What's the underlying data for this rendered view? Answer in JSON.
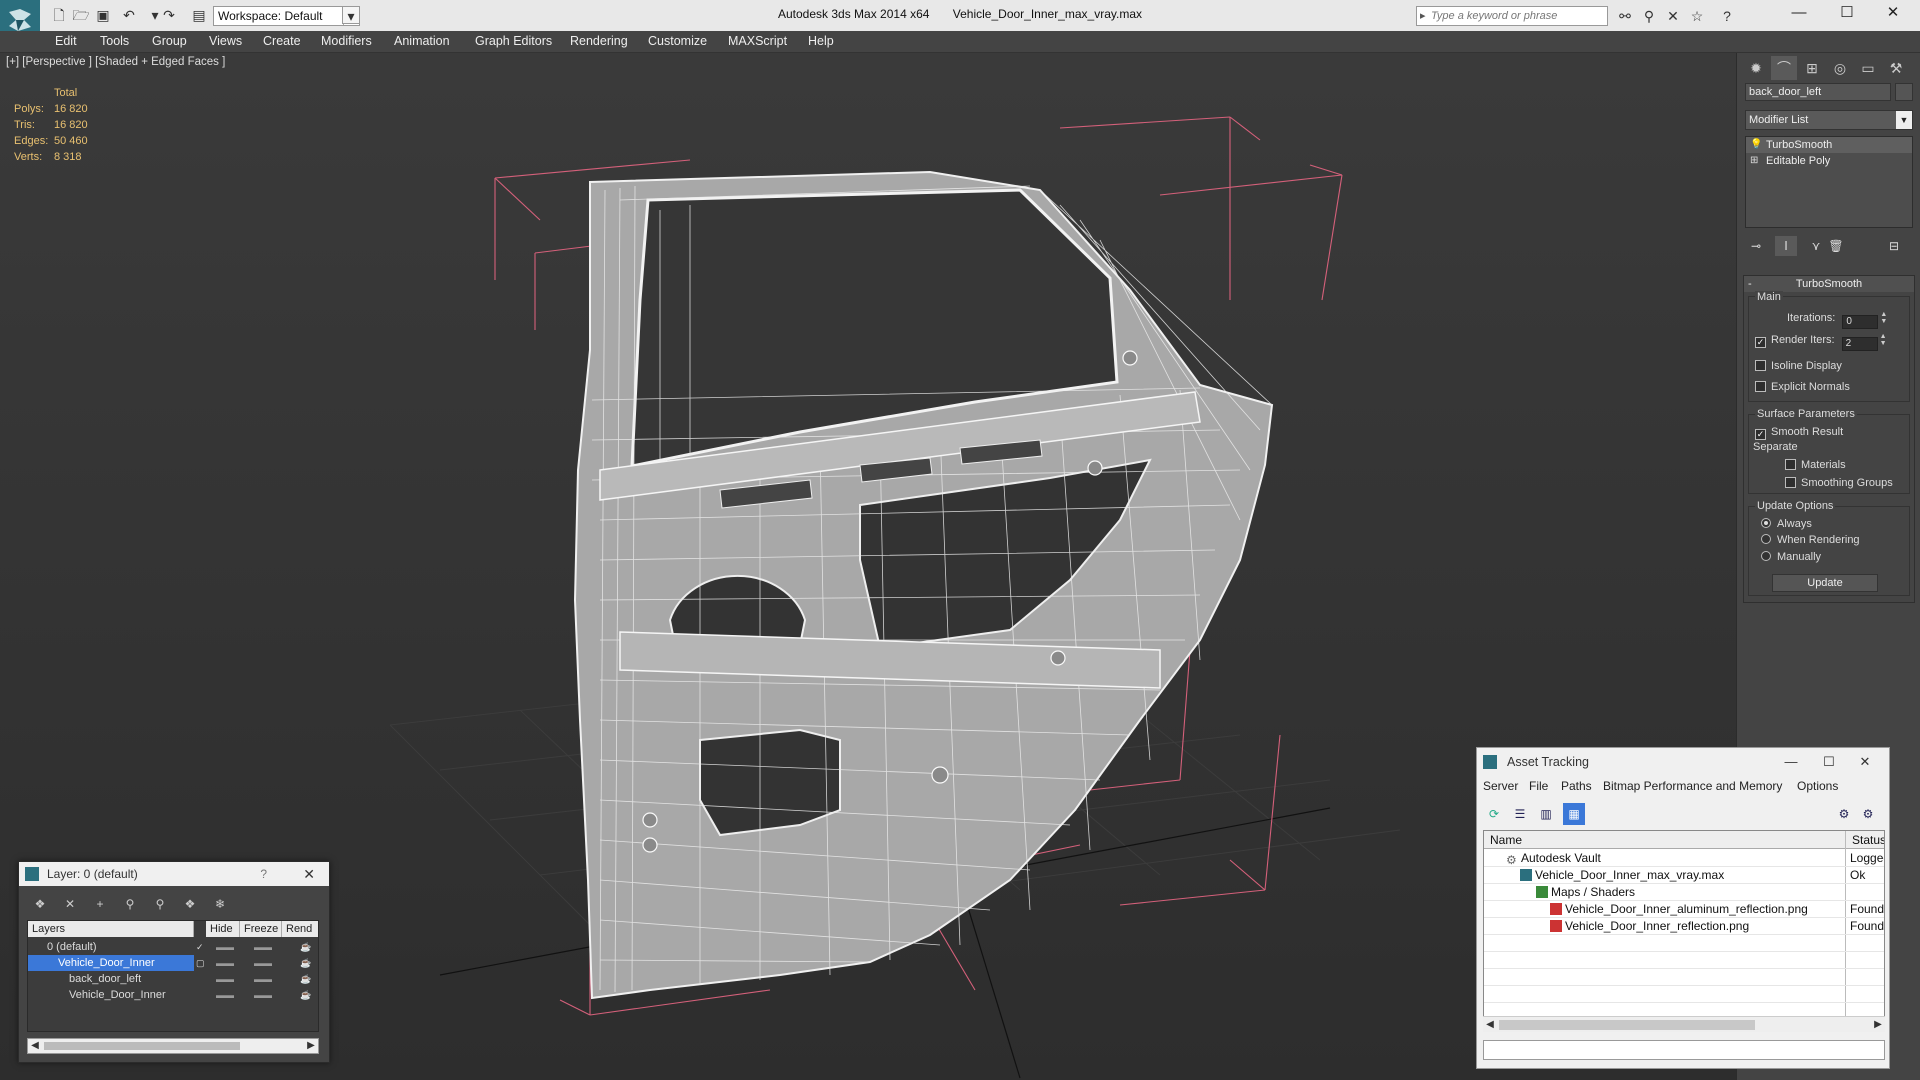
{
  "titlebar": {
    "workspace": "Workspace: Default",
    "app_title": "Autodesk 3ds Max  2014 x64",
    "file_title": "Vehicle_Door_Inner_max_vray.max",
    "search_placeholder": "Type a keyword or phrase"
  },
  "menu": [
    "Edit",
    "Tools",
    "Group",
    "Views",
    "Create",
    "Modifiers",
    "Animation",
    "Graph Editors",
    "Rendering",
    "Customize",
    "MAXScript",
    "Help"
  ],
  "viewport": {
    "label": "[+] [Perspective ] [Shaded + Edged Faces ]",
    "stats": {
      "header": "Total",
      "rows": [
        {
          "label": "Polys:",
          "value": "16 820"
        },
        {
          "label": "Tris:",
          "value": "16 820"
        },
        {
          "label": "Edges:",
          "value": "50 460"
        },
        {
          "label": "Verts:",
          "value": "8 318"
        }
      ]
    }
  },
  "command_panel": {
    "object_name": "back_door_left",
    "modifier_list": "Modifier List",
    "stack": [
      "TurboSmooth",
      "Editable Poly"
    ],
    "rollout": {
      "title": "TurboSmooth",
      "main_label": "Main",
      "iterations_label": "Iterations:",
      "iterations_value": "0",
      "render_iters_label": "Render Iters:",
      "render_iters_value": "2",
      "render_iters_checked": true,
      "isoline_label": "Isoline Display",
      "isoline_checked": false,
      "explicit_normals_label": "Explicit Normals",
      "explicit_normals_checked": false,
      "surface_params_label": "Surface Parameters",
      "smooth_result_label": "Smooth Result",
      "smooth_result_checked": true,
      "separate_label": "Separate",
      "materials_label": "Materials",
      "smoothing_groups_label": "Smoothing Groups",
      "update_options_label": "Update Options",
      "always_label": "Always",
      "when_rendering_label": "When Rendering",
      "manually_label": "Manually",
      "update_button": "Update"
    }
  },
  "layer_dialog": {
    "title": "Layer: 0 (default)",
    "help": "?",
    "columns": [
      "Layers",
      "Hide",
      "Freeze",
      "Rend"
    ],
    "rows": [
      {
        "name": "0 (default)"
      },
      {
        "name": "Vehicle_Door_Inner"
      },
      {
        "name": "back_door_left"
      },
      {
        "name": "Vehicle_Door_Inner"
      }
    ]
  },
  "asset_dialog": {
    "title": "Asset Tracking",
    "menu": [
      "Server",
      "File",
      "Paths",
      "Bitmap Performance and Memory",
      "Options"
    ],
    "columns": [
      "Name",
      "Status"
    ],
    "rows": [
      {
        "name": "Autodesk Vault",
        "status": "Logged Out"
      },
      {
        "name": "Vehicle_Door_Inner_max_vray.max",
        "status": "Ok"
      },
      {
        "name": "Maps / Shaders",
        "status": ""
      },
      {
        "name": "Vehicle_Door_Inner_aluminum_reflection.png",
        "status": "Found"
      },
      {
        "name": "Vehicle_Door_Inner_reflection.png",
        "status": "Found"
      }
    ]
  },
  "colors": {
    "accent_select": "#3b78d8",
    "stats_text": "#e8c070",
    "bbox_lines": "#d4607a",
    "app_logo": "#2b6f7e"
  }
}
